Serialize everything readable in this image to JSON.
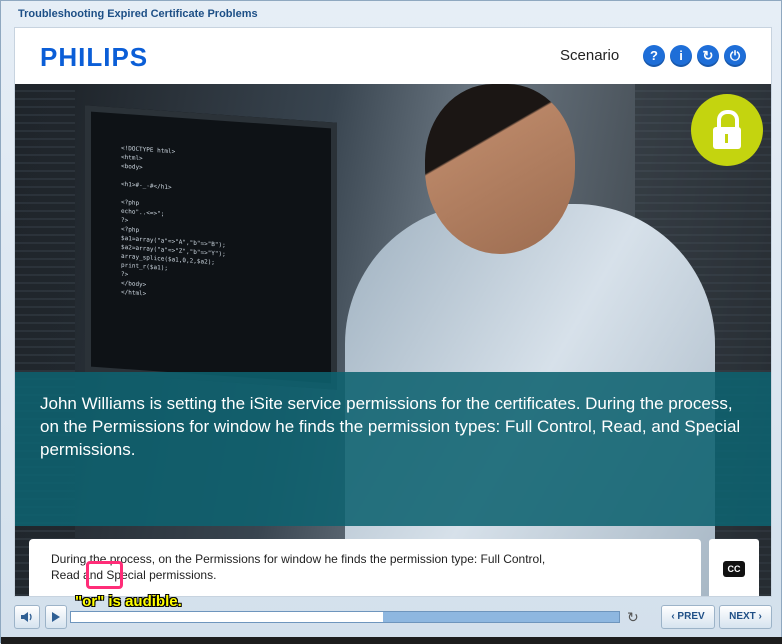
{
  "window": {
    "title": "Troubleshooting Expired Certificate Problems"
  },
  "header": {
    "brand": "PHILIPS",
    "section_label": "Scenario",
    "buttons": [
      {
        "name": "help",
        "glyph": "?"
      },
      {
        "name": "info",
        "glyph": "i"
      },
      {
        "name": "replay",
        "glyph": "↻"
      },
      {
        "name": "power",
        "glyph": "⏻"
      }
    ]
  },
  "scene": {
    "code_text": "<!DOCTYPE html>\n<html>\n<body>\n\n<h1>#-_-#</h1>\n\n<?php\necho\"..<=>\";\n?>\n<?php\n$a1=array(\"a\"=>\"A\",\"b\"=>\"B\");\n$a2=array(\"a\"=>\"Z\",\"b\"=>\"Y\");\narray_splice($a1,0,2,$a2);\nprint_r($a1);\n?>\n</body>\n</html>",
    "caption": "John Williams is setting the iSite service permissions for the certificates. During the process, on the Permissions for window he finds the permission types: Full Control, Read, and Special permissions.",
    "lock_color": "#c4d40f"
  },
  "subtitle": {
    "line1": "During the process, on the Permissions for window he finds the permission type: Full Control,",
    "line2": "Read and Special permissions.",
    "cc_label": "CC"
  },
  "annotation": {
    "note": "\"or\" is audible."
  },
  "player": {
    "prev_label": "‹ PREV",
    "next_label": "NEXT ›",
    "progress": 0.57
  }
}
